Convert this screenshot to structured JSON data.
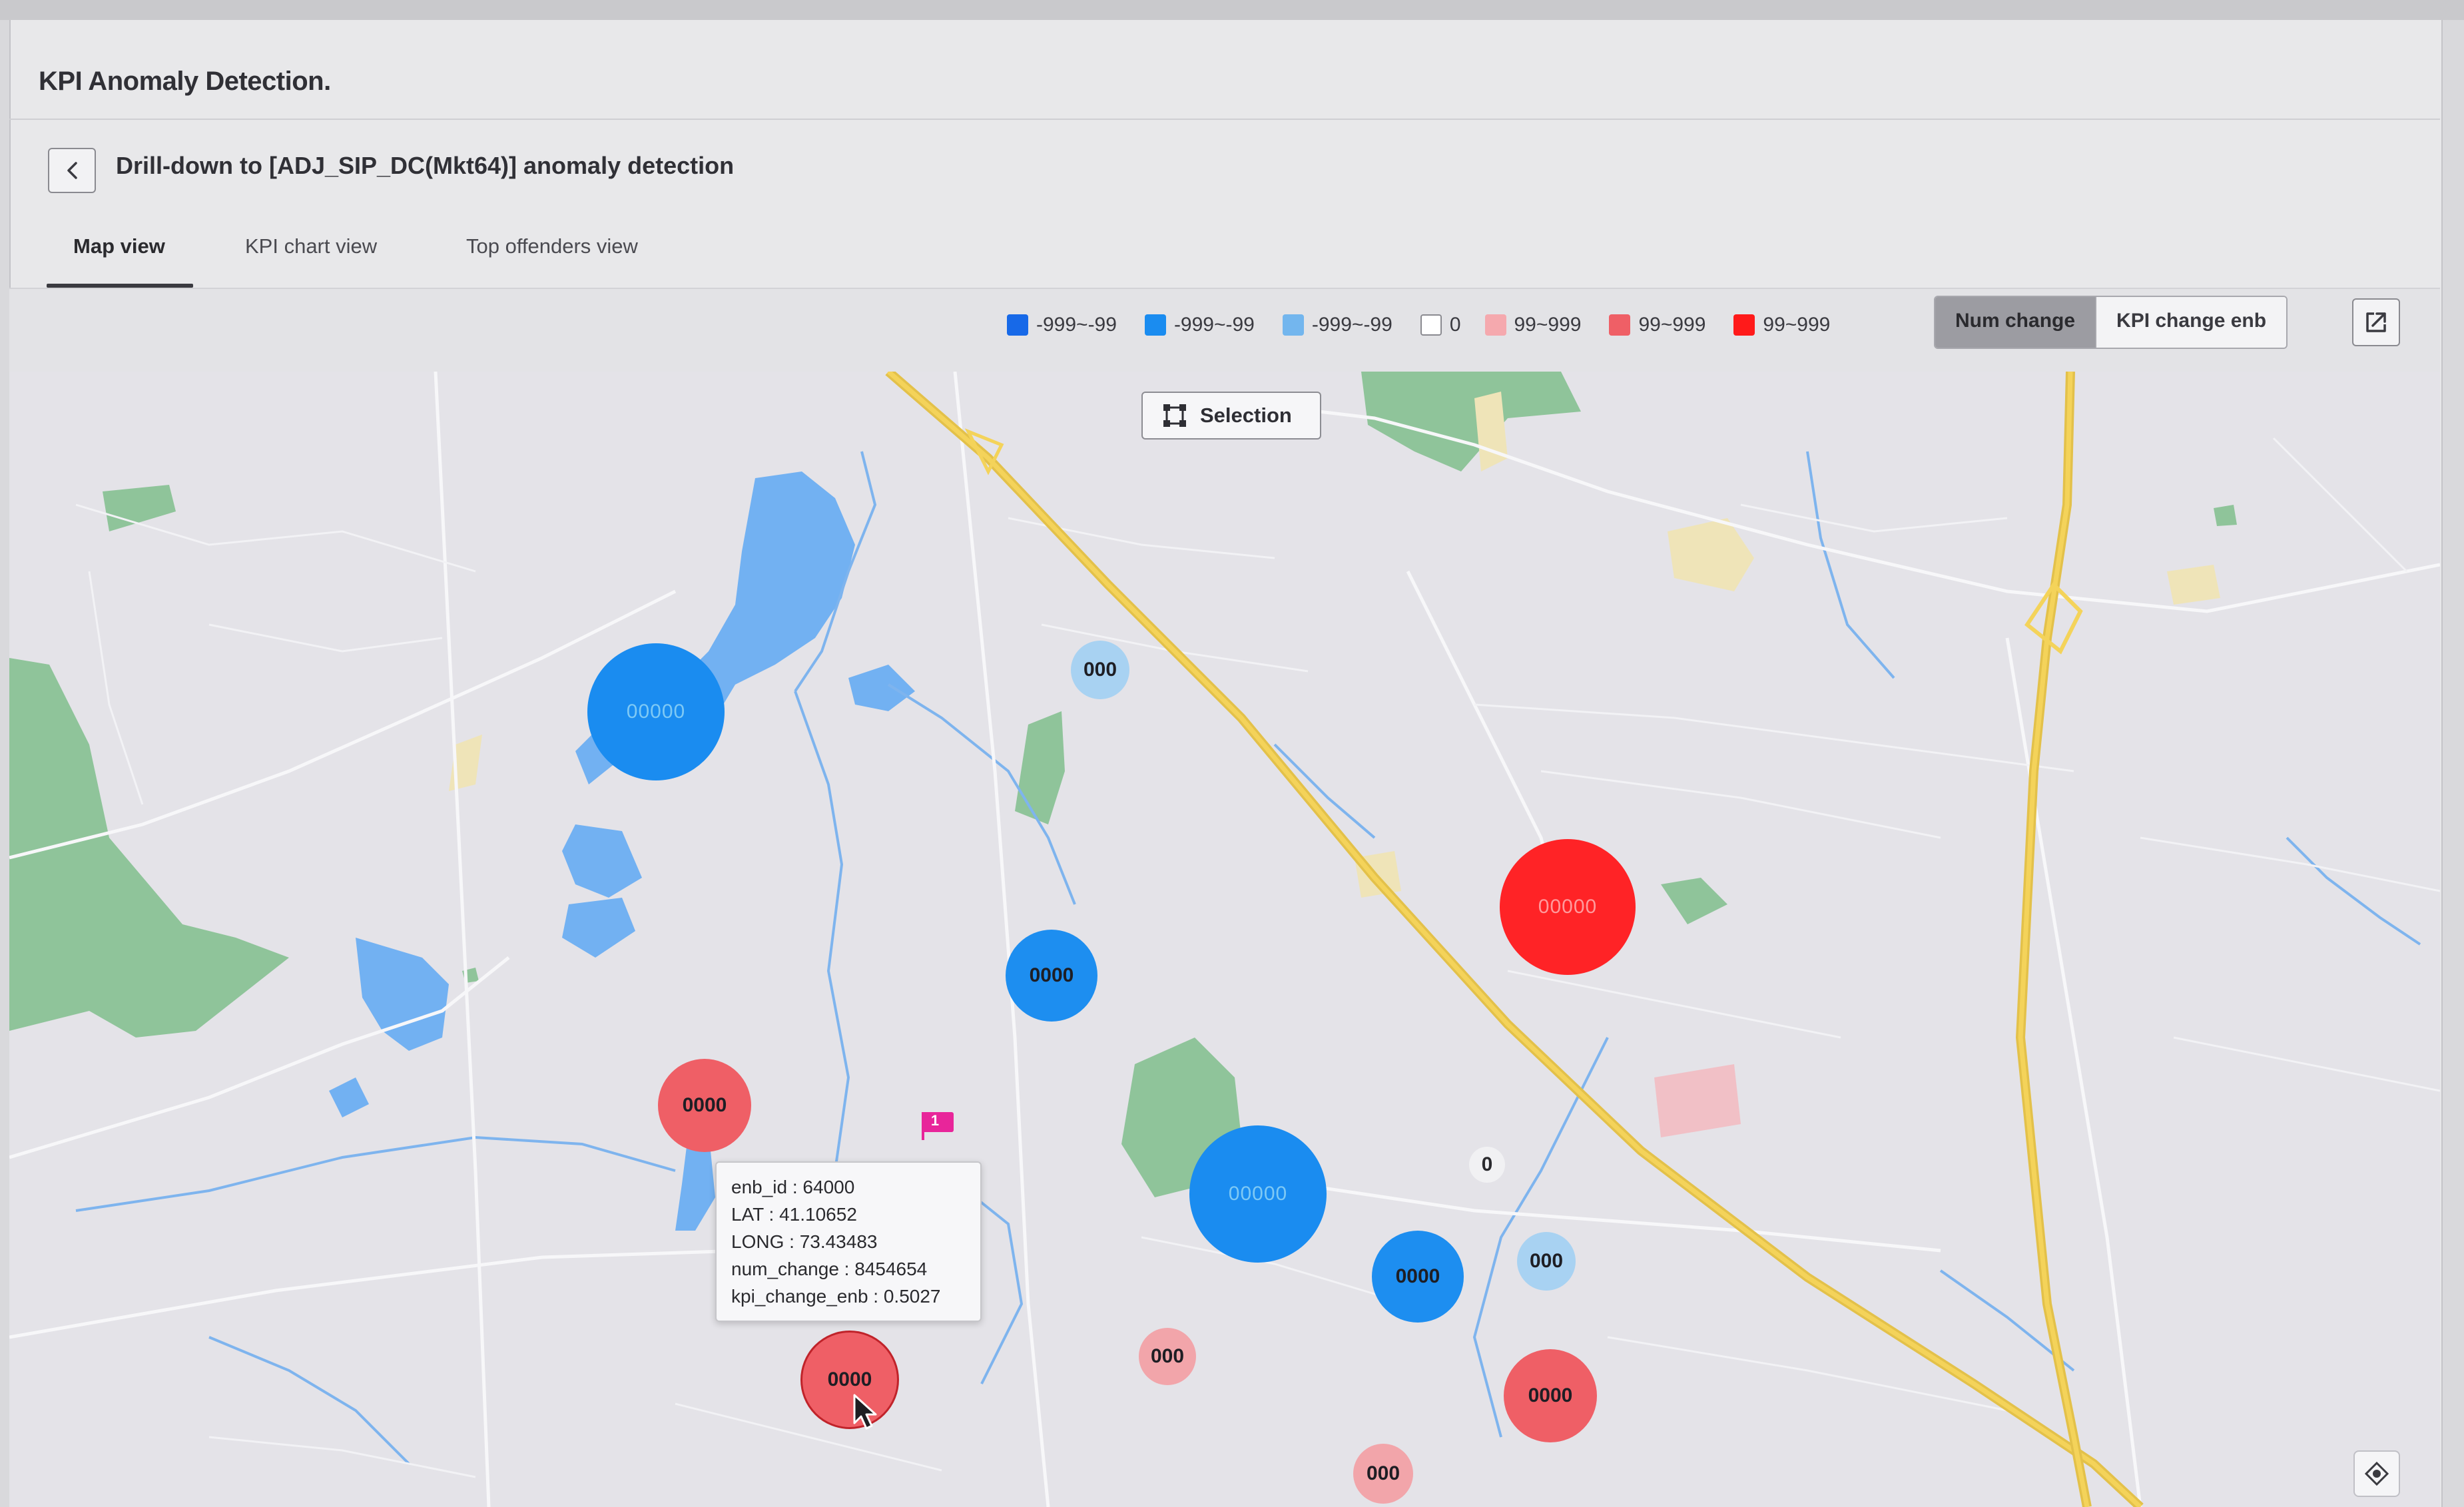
{
  "page": {
    "title": "KPI Anomaly Detection.",
    "drilldown_title": "Drill-down to [ADJ_SIP_DC(Mkt64)] anomaly detection"
  },
  "tabs": [
    {
      "label": "Map view",
      "active": true
    },
    {
      "label": "KPI chart view",
      "active": false
    },
    {
      "label": "Top offenders view",
      "active": false
    }
  ],
  "legend": [
    {
      "label": "-999~-99",
      "color": "#1769e8"
    },
    {
      "label": "-999~-99",
      "color": "#1a8cf0"
    },
    {
      "label": "-999~-99",
      "color": "#73b6ee"
    },
    {
      "label": "0",
      "color": "#ffffff"
    },
    {
      "label": "99~999",
      "color": "#f5a9ae"
    },
    {
      "label": "99~999",
      "color": "#ef5f66"
    },
    {
      "label": "99~999",
      "color": "#ff1a1a"
    }
  ],
  "toggle": {
    "options": [
      "Num change",
      "KPI change enb"
    ],
    "selected": "Num change"
  },
  "map": {
    "selection_label": "Selection",
    "bubbles": [
      "00000",
      "000",
      "00000",
      "0000",
      "0000",
      "00000",
      "0",
      "0000",
      "000",
      "000",
      "0000",
      "0000",
      "000"
    ],
    "flag_label": "1"
  },
  "tooltip": {
    "lines": [
      "enb_id : 64000",
      "LAT : 41.10652",
      "LONG : 73.43483",
      "num_change : 8454654",
      "kpi_change_enb : 0.5027"
    ]
  },
  "icons": [
    "chevron-left-icon",
    "selection-icon",
    "export-icon",
    "locate-icon",
    "flag-icon",
    "cursor-icon"
  ]
}
